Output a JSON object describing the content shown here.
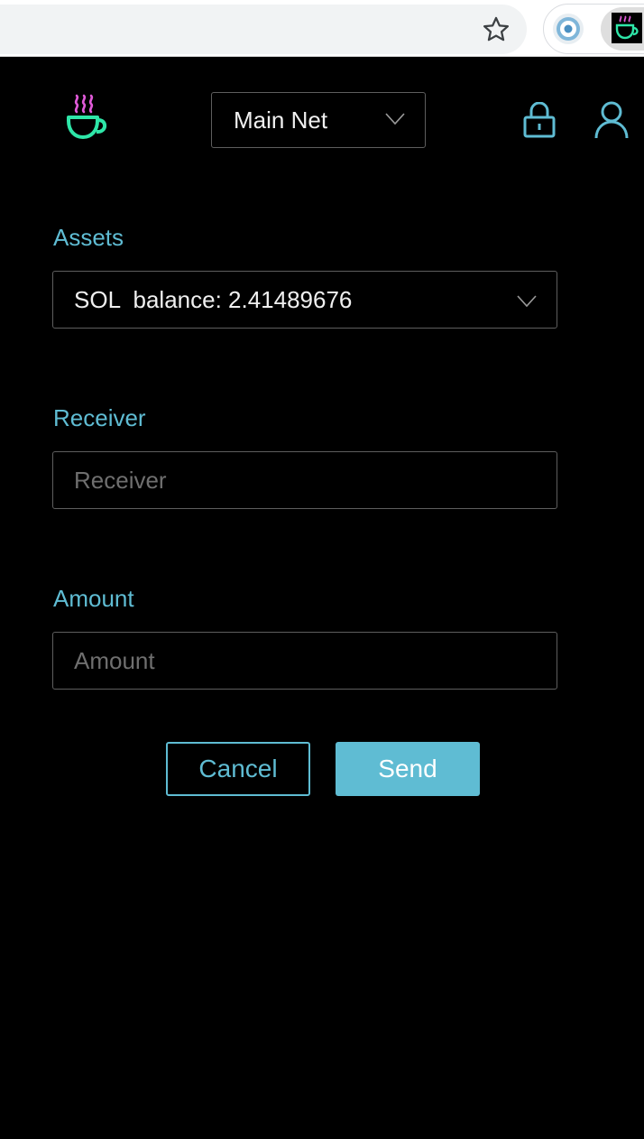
{
  "browser": {
    "icons": [
      "star-icon",
      "eye-extension-icon",
      "coffee-cup-extension-icon"
    ]
  },
  "header": {
    "logo_icon": "coffee-cup-logo",
    "network": "Main Net",
    "lock_icon": "lock-icon",
    "account_icon": "user-icon"
  },
  "form": {
    "assets_label": "Assets",
    "asset_selected": "SOL  balance: 2.41489676",
    "receiver_label": "Receiver",
    "receiver_placeholder": "Receiver",
    "receiver_value": "",
    "amount_label": "Amount",
    "amount_placeholder": "Amount",
    "amount_value": ""
  },
  "actions": {
    "cancel_label": "Cancel",
    "send_label": "Send"
  },
  "colors": {
    "background": "#000000",
    "accent": "#5fbcd3",
    "logo_green": "#2ee6a8",
    "logo_pink": "#e05ad8"
  }
}
